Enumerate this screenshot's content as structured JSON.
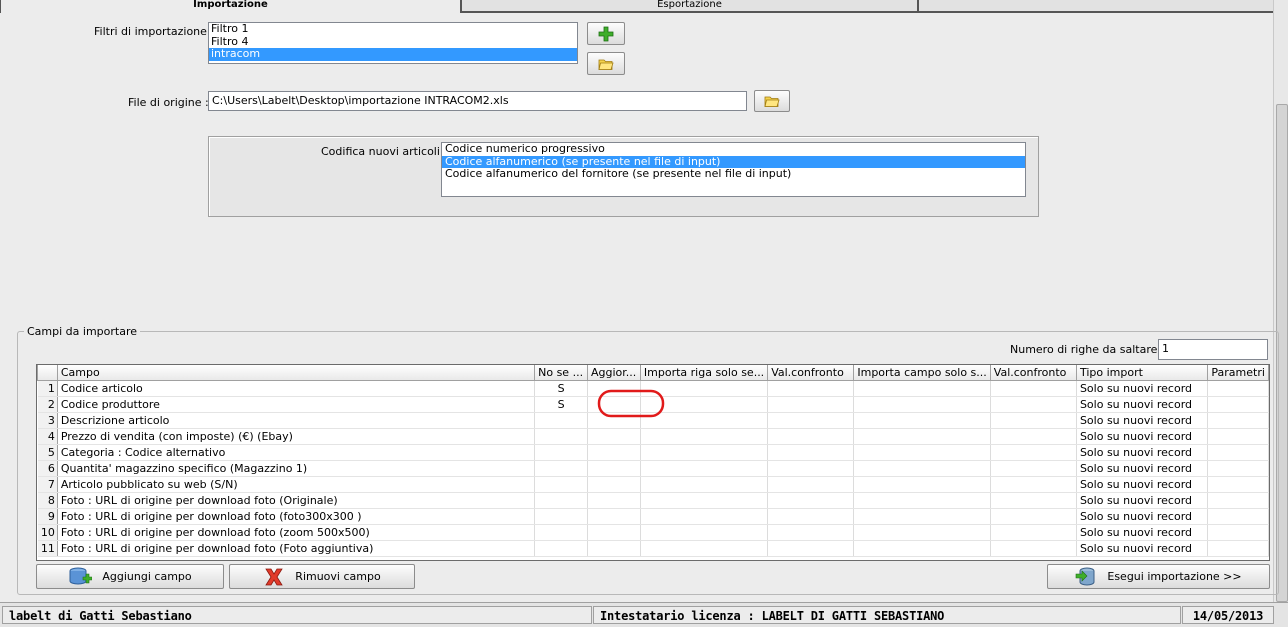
{
  "tabs": {
    "import_label": "Importazione",
    "export_label": "Esportazione"
  },
  "filters": {
    "label": "Filtri di importazione :",
    "items": [
      "Filtro 1",
      "Filtro 4",
      "intracom"
    ],
    "selected": "intracom",
    "add_icon": "plus-icon",
    "open_icon": "folder-icon"
  },
  "source_file": {
    "label": "File di origine :",
    "value": "C:\\Users\\Labelt\\Desktop\\importazione INTRACOM2.xls",
    "browse_icon": "folder-icon"
  },
  "coding": {
    "label": "Codifica nuovi articoli :",
    "options": [
      "Codice numerico progressivo",
      "Codice alfanumerico (se presente nel file di input)",
      "Codice alfanumerico del fornitore (se presente nel file di input)"
    ],
    "selected": "Codice alfanumerico (se presente nel file di input)"
  },
  "fields_group": {
    "title": "Campi da importare",
    "skip_rows_label": "Numero di righe da saltare :",
    "skip_rows_value": "1"
  },
  "grid": {
    "columns": [
      "Campo",
      "No se ...",
      "Aggior...",
      "Importa riga solo se...",
      "Val.confronto",
      "Importa campo solo s...",
      "Val.confronto",
      "Tipo import",
      "Parametri"
    ],
    "rows": [
      {
        "n": "1",
        "campo": "Codice articolo",
        "no_se": "S",
        "tipo": "Solo su nuovi record"
      },
      {
        "n": "2",
        "campo": "Codice produttore",
        "no_se": "S",
        "tipo": "Solo su nuovi record"
      },
      {
        "n": "3",
        "campo": "Descrizione articolo",
        "no_se": "",
        "tipo": "Solo su nuovi record"
      },
      {
        "n": "4",
        "campo": "Prezzo di vendita (con imposte) (€) (Ebay)",
        "no_se": "",
        "tipo": "Solo su nuovi record"
      },
      {
        "n": "5",
        "campo": "Categoria : Codice alternativo",
        "no_se": "",
        "tipo": "Solo su nuovi record"
      },
      {
        "n": "6",
        "campo": "Quantita' magazzino specifico (Magazzino 1)",
        "no_se": "",
        "tipo": "Solo su nuovi record"
      },
      {
        "n": "7",
        "campo": "Articolo pubblicato su web (S/N)",
        "no_se": "",
        "tipo": "Solo su nuovi record"
      },
      {
        "n": "8",
        "campo": "Foto : URL di origine per download foto (Originale)",
        "no_se": "",
        "tipo": "Solo su nuovi record"
      },
      {
        "n": "9",
        "campo": "Foto : URL di origine per download foto (foto300x300 )",
        "no_se": "",
        "tipo": "Solo su nuovi record"
      },
      {
        "n": "10",
        "campo": "Foto : URL di origine per download foto (zoom 500x500)",
        "no_se": "",
        "tipo": "Solo su nuovi record"
      },
      {
        "n": "11",
        "campo": "Foto : URL di origine per download foto (Foto aggiuntiva)",
        "no_se": "",
        "tipo": "Solo su nuovi record"
      }
    ]
  },
  "buttons": {
    "add_field": "Aggiungi campo",
    "add_field_icon": "database-add-icon",
    "remove_field": "Rimuovi campo",
    "remove_field_icon": "red-x-icon",
    "run_import": "Esegui importazione >>",
    "run_import_icon": "database-arrow-icon"
  },
  "status": {
    "company": "labelt di Gatti Sebastiano",
    "license": "Intestatario licenza : LABELT DI GATTI SEBASTIANO",
    "date": "14/05/2013"
  },
  "colors": {
    "selection": "#3399ff",
    "annotation": "#e11a1a"
  }
}
